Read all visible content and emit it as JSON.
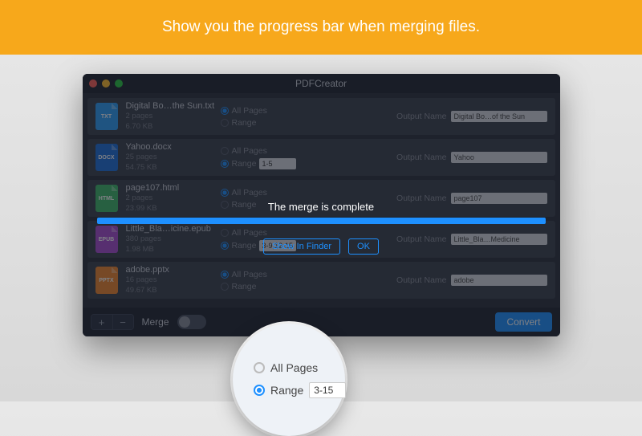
{
  "banner": {
    "headline": "Show you the progress bar when merging files."
  },
  "window": {
    "title": "PDFCreator"
  },
  "labels": {
    "all_pages": "All Pages",
    "range": "Range",
    "output_name": "Output Name",
    "merge": "Merge",
    "convert": "Convert",
    "show_in_finder": "Show In Finder",
    "ok": "OK"
  },
  "progress": {
    "message": "The merge is complete"
  },
  "files": [
    {
      "name": "Digital Bo…the Sun.txt",
      "pages": "2 pages",
      "size": "6.70 KB",
      "type": "TXT",
      "range": "",
      "output": "Digital Bo…of the Sun",
      "sel": "all"
    },
    {
      "name": "Yahoo.docx",
      "pages": "25 pages",
      "size": "54.75 KB",
      "type": "DOCX",
      "range": "1-5",
      "output": "Yahoo",
      "sel": "range"
    },
    {
      "name": "page107.html",
      "pages": "2 pages",
      "size": "23.99 KB",
      "type": "HTML",
      "range": "",
      "output": "page107",
      "sel": "all"
    },
    {
      "name": "Little_Bla…icine.epub",
      "pages": "380 pages",
      "size": "1.98 MB",
      "type": "EPUB",
      "range": "3-9,12-15",
      "output": "Little_Bla…Medicine",
      "sel": "range"
    },
    {
      "name": "adobe.pptx",
      "pages": "16 pages",
      "size": "49.67 KB",
      "type": "PPTX",
      "range": "",
      "output": "adobe",
      "sel": "all"
    }
  ],
  "zoom": {
    "all_pages": "All Pages",
    "range": "Range",
    "value": "3-15"
  }
}
